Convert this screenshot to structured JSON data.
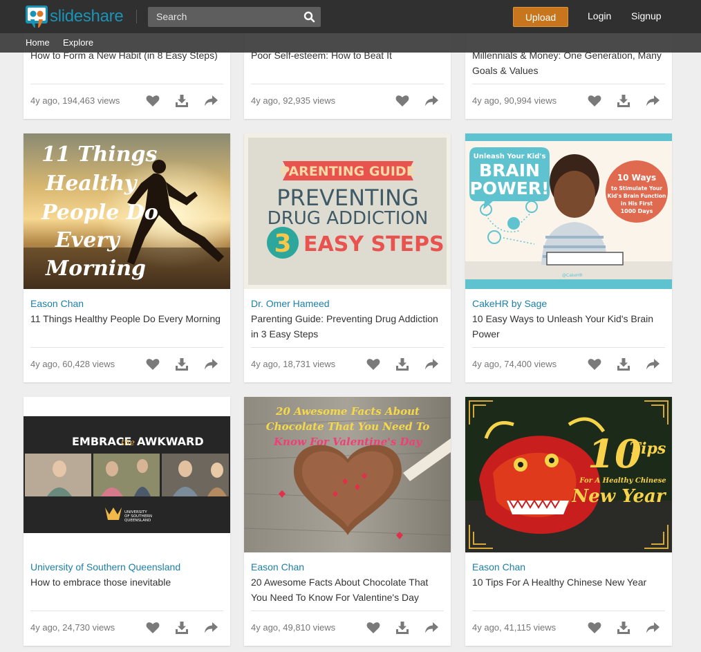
{
  "header": {
    "logo_text": "slideshare",
    "search_placeholder": "Search",
    "upload_label": "Upload",
    "login_label": "Login",
    "signup_label": "Signup",
    "brand_color": "#1a93b7",
    "upload_color": "#c7761d"
  },
  "subnav": {
    "items": [
      "Home",
      "Explore"
    ]
  },
  "cards": [
    {
      "author": "",
      "title": "How to Form a New Habit (in 8 Easy Steps)",
      "meta": "4y ago, 194,463 views"
    },
    {
      "author": "",
      "title": "Poor Self-esteem: How to Beat It",
      "meta": "4y ago, 92,935 views"
    },
    {
      "author": "",
      "title": "Millennials & Money: One Generation, Many Goals & Values",
      "meta": "4y ago, 90,994 views"
    },
    {
      "author": "Eason Chan",
      "title": "11 Things Healthy People Do Every Morning",
      "meta": "4y ago, 60,428 views",
      "thumb": {
        "lines": [
          "11 Things",
          "Healthy",
          "People Do",
          "Every",
          "Morning"
        ]
      }
    },
    {
      "author": "Dr. Omer Hameed",
      "title": "Parenting Guide: Preventing Drug Addiction in 3 Easy Steps",
      "meta": "4y ago, 18,731 views",
      "thumb": {
        "banner": "PARENTING GUIDE",
        "line1": "PREVENTING",
        "line2": "DRUG ADDICTION",
        "number": "3",
        "steps": "EASY STEPS"
      }
    },
    {
      "author": "CakeHR by Sage",
      "title": "10 Easy Ways to Unleash Your Kid's Brain Power",
      "meta": "4y ago, 74,400 views",
      "thumb": {
        "small": "Unleash Your Kid's",
        "big1": "BRAIN",
        "big2": "POWER!",
        "circle1": "10 Ways",
        "circle2": "to Stimulate Your",
        "circle3": "Kid's Brain Function",
        "circle4": "in His First",
        "circle5": "1000 Days",
        "handle": "@CakeHR"
      }
    },
    {
      "author": "University of Southern Queensland",
      "title": "How to embrace those inevitable",
      "meta": "4y ago, 24,730 views",
      "thumb": {
        "w1": "EMBRACE",
        "w2": "the",
        "w3": "AWKWARD",
        "uni1": "UNIVERSITY",
        "uni2": "OF SOUTHERN",
        "uni3": "QUEENSLAND"
      }
    },
    {
      "author": "Eason Chan",
      "title": "20 Awesome Facts About Chocolate That You Need To Know For Valentine's Day",
      "meta": "4y ago, 49,810 views",
      "thumb": {
        "l1": "20 Awesome Facts About",
        "l2": "Chocolate That You Need To",
        "l3": "Know For Valentine's Day"
      }
    },
    {
      "author": "Eason Chan",
      "title": "10 Tips For A Healthy Chinese New Year",
      "meta": "4y ago, 41,115 views",
      "thumb": {
        "num": "10",
        "tips": "Tips",
        "sub": "For A Healthy Chinese",
        "ny": "New Year"
      }
    }
  ]
}
